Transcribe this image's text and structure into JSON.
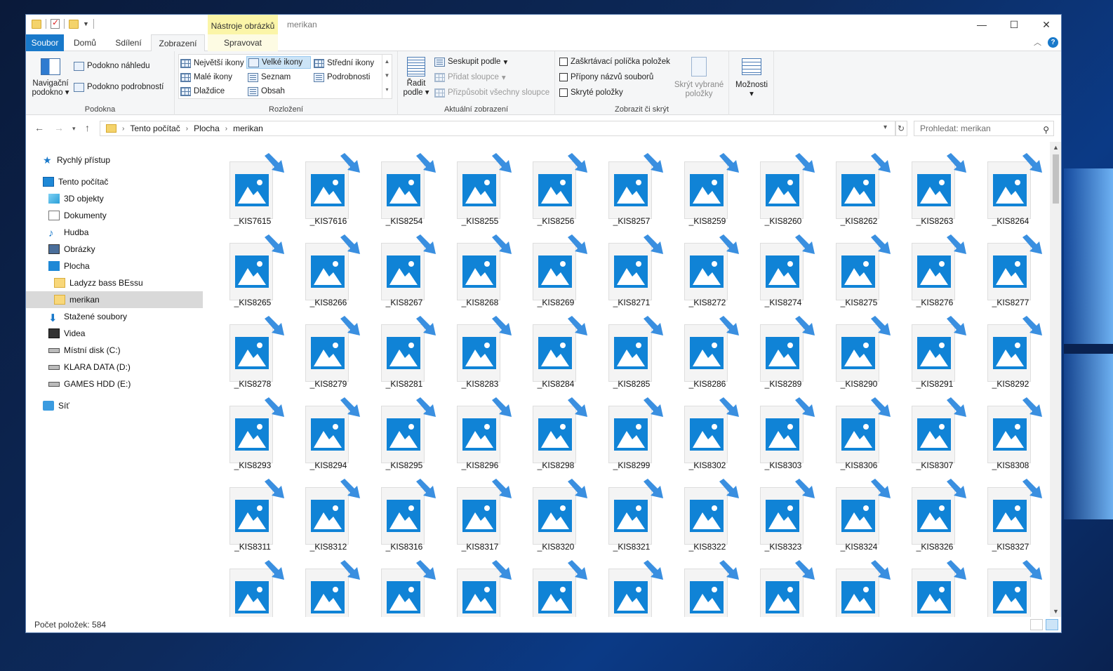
{
  "window": {
    "title": "merikan",
    "context_tab_group": "Nástroje obrázků"
  },
  "tabs": [
    {
      "label": "Soubor"
    },
    {
      "label": "Domů"
    },
    {
      "label": "Sdílení"
    },
    {
      "label": "Zobrazení"
    },
    {
      "label": "Spravovat"
    }
  ],
  "ribbon": {
    "panes": {
      "label": "Podokna",
      "nav_pane": "Navigační podokno",
      "preview_pane": "Podokno náhledu",
      "details_pane": "Podokno podrobností"
    },
    "layout": {
      "label": "Rozložení",
      "items": [
        "Největší ikony",
        "Velké ikony",
        "Střední ikony",
        "Malé ikony",
        "Seznam",
        "Podrobnosti",
        "Dlaždice",
        "Obsah"
      ],
      "selected": "Velké ikony"
    },
    "current_view": {
      "label": "Aktuální zobrazení",
      "sort_by": "Řadit podle",
      "group_by": "Seskupit podle",
      "add_columns": "Přidat sloupce",
      "fit_columns": "Přizpůsobit všechny sloupce"
    },
    "show_hide": {
      "label": "Zobrazit či skrýt",
      "item_checkboxes": "Zaškrtávací políčka položek",
      "file_extensions": "Přípony názvů souborů",
      "hidden_items": "Skryté položky",
      "hide_selected": "Skrýt vybrané položky"
    },
    "options": "Možnosti"
  },
  "address": {
    "crumbs": [
      "Tento počítač",
      "Plocha",
      "merikan"
    ],
    "search_placeholder": "Prohledat: merikan"
  },
  "nav": {
    "quick_access": "Rychlý přístup",
    "this_pc": "Tento počítač",
    "items": [
      {
        "label": "3D objekty",
        "icon": "cube-icon"
      },
      {
        "label": "Dokumenty",
        "icon": "document-icon"
      },
      {
        "label": "Hudba",
        "icon": "music-icon"
      },
      {
        "label": "Obrázky",
        "icon": "pictures-icon"
      },
      {
        "label": "Plocha",
        "icon": "desktop-icon"
      },
      {
        "label": "Ladyzz bass BEssu",
        "icon": "folder-icon"
      },
      {
        "label": "merikan",
        "icon": "folder-icon"
      },
      {
        "label": "Stažené soubory",
        "icon": "download-icon"
      },
      {
        "label": "Videa",
        "icon": "video-icon"
      },
      {
        "label": "Místní disk (C:)",
        "icon": "drive-icon"
      },
      {
        "label": "KLARA DATA (D:)",
        "icon": "drive-icon"
      },
      {
        "label": "GAMES HDD (E:)",
        "icon": "drive-icon"
      }
    ],
    "network": "Síť"
  },
  "files": [
    "_KIS7615",
    "_KIS7616",
    "_KIS8254",
    "_KIS8255",
    "_KIS8256",
    "_KIS8257",
    "_KIS8259",
    "_KIS8260",
    "_KIS8262",
    "_KIS8263",
    "_KIS8264",
    "_KIS8265",
    "_KIS8266",
    "_KIS8267",
    "_KIS8268",
    "_KIS8269",
    "_KIS8271",
    "_KIS8272",
    "_KIS8274",
    "_KIS8275",
    "_KIS8276",
    "_KIS8277",
    "_KIS8278",
    "_KIS8279",
    "_KIS8281",
    "_KIS8283",
    "_KIS8284",
    "_KIS8285",
    "_KIS8286",
    "_KIS8289",
    "_KIS8290",
    "_KIS8291",
    "_KIS8292",
    "_KIS8293",
    "_KIS8294",
    "_KIS8295",
    "_KIS8296",
    "_KIS8298",
    "_KIS8299",
    "_KIS8302",
    "_KIS8303",
    "_KIS8306",
    "_KIS8307",
    "_KIS8308",
    "_KIS8311",
    "_KIS8312",
    "_KIS8316",
    "_KIS8317",
    "_KIS8320",
    "_KIS8321",
    "_KIS8322",
    "_KIS8323",
    "_KIS8324",
    "_KIS8326",
    "_KIS8327",
    "",
    "",
    "",
    "",
    "",
    "",
    "",
    "",
    "",
    "",
    ""
  ],
  "status": {
    "item_count": "Počet položek: 584"
  },
  "colors": {
    "accent": "#1979ca",
    "image_icon": "#1083d6",
    "context_tab": "#fbf5a8"
  }
}
